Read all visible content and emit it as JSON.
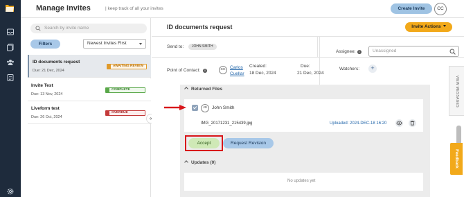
{
  "header": {
    "title": "Manage Invites",
    "subtitle": "| keep track of all your invites",
    "create_button": "Create Invite",
    "user_initials": "CC"
  },
  "sidebar": {
    "search_placeholder": "Search by invite name",
    "filters_label": "Filters",
    "sort_value": "Newest Invites First",
    "invites": [
      {
        "name": "ID documents request",
        "due": "Due: 21 Dec, 2024",
        "status": "AWAITING REVIEW",
        "selected": true
      },
      {
        "name": "Invite Test",
        "due": "Due: 13 Nov, 2024",
        "status": "COMPLETE",
        "selected": false
      },
      {
        "name": "Liveform test",
        "due": "Due: 26 Oct, 2024",
        "status": "OVERDUE",
        "selected": false
      }
    ],
    "collapse_glyph": "«"
  },
  "detail": {
    "title": "ID documents request",
    "actions_button": "Invite Actions",
    "send_to_label": "Send to:",
    "send_to_value": "JOHN SMITH",
    "assignee_label": "Assignee:",
    "assignee_placeholder": "Unassigned",
    "poc_label": "Point of Contact:",
    "poc_initials": "CC",
    "poc_first": "Carlos",
    "poc_last": "Cuellar",
    "created_label": "Created:",
    "created_value": "18 Dec, 2024",
    "due_label": "Due:",
    "due_value": "21 Dec, 2024",
    "watchers_label": "Watchers:",
    "watchers_add": "+"
  },
  "returned_files": {
    "heading": "Returned Files",
    "submitter_initials": "JS",
    "submitter_name": "John Smith",
    "file_name": "IMG_20171231_215439.jpg",
    "uploaded": "Uploaded: 2024-DEC-18 16:20",
    "accept_label": "Accept",
    "revision_label": "Request Revision"
  },
  "updates": {
    "heading": "Updates (0)",
    "empty_text": "No updates yet"
  },
  "side_tabs": {
    "view_messages": "VIEW MESSAGES",
    "feedback": "Feedback"
  },
  "colors": {
    "rail": "#1e2b3c",
    "accent_orange": "#f2a91a",
    "accent_blue": "#a8c8e8",
    "highlight_red": "#d8151a",
    "accept_green": "#cfe9b6"
  }
}
